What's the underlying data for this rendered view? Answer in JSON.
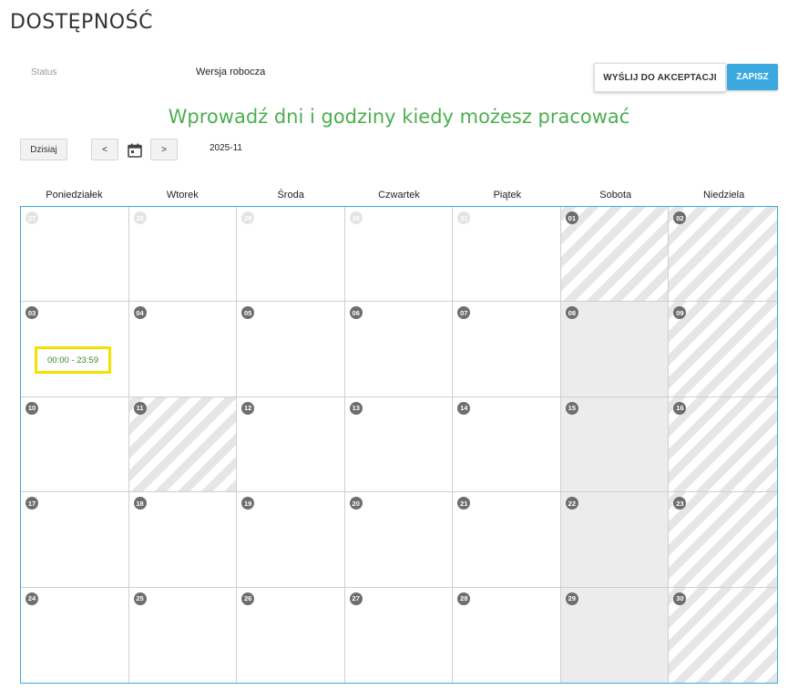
{
  "header": {
    "title": "DOSTĘPNOŚĆ"
  },
  "status": {
    "label": "Status",
    "value": "Wersja robocza"
  },
  "actions": {
    "send_label": "WYŚLIJ DO AKCEPTACJI",
    "save_label": "ZAPISZ"
  },
  "instructions": "Wprowadź dni i godziny kiedy możesz pracować",
  "toolbar": {
    "today_label": "Dzisiaj",
    "prev_label": "<",
    "next_label": ">",
    "calendar_icon": "calendar-icon",
    "month": "2025-11"
  },
  "colors": {
    "accent": "#3ba9e0",
    "instructions_green": "#4caf50",
    "highlight_yellow": "#f5e000"
  },
  "weekdays": [
    "Poniedziałek",
    "Wtorek",
    "Środa",
    "Czwartek",
    "Piątek",
    "Sobota",
    "Niedziela"
  ],
  "weeks": [
    [
      {
        "day": "27",
        "state": "outside"
      },
      {
        "day": "28",
        "state": "outside"
      },
      {
        "day": "29",
        "state": "outside"
      },
      {
        "day": "30",
        "state": "outside"
      },
      {
        "day": "31",
        "state": "outside"
      },
      {
        "day": "01",
        "state": "striped"
      },
      {
        "day": "02",
        "state": "striped"
      }
    ],
    [
      {
        "day": "03",
        "state": "normal",
        "slot": "00:00 - 23:59"
      },
      {
        "day": "04",
        "state": "normal"
      },
      {
        "day": "05",
        "state": "normal"
      },
      {
        "day": "06",
        "state": "normal"
      },
      {
        "day": "07",
        "state": "normal"
      },
      {
        "day": "08",
        "state": "gray"
      },
      {
        "day": "09",
        "state": "striped"
      }
    ],
    [
      {
        "day": "10",
        "state": "normal"
      },
      {
        "day": "11",
        "state": "striped"
      },
      {
        "day": "12",
        "state": "normal"
      },
      {
        "day": "13",
        "state": "normal"
      },
      {
        "day": "14",
        "state": "normal"
      },
      {
        "day": "15",
        "state": "gray"
      },
      {
        "day": "16",
        "state": "striped"
      }
    ],
    [
      {
        "day": "17",
        "state": "normal"
      },
      {
        "day": "18",
        "state": "normal"
      },
      {
        "day": "19",
        "state": "normal"
      },
      {
        "day": "20",
        "state": "normal"
      },
      {
        "day": "21",
        "state": "normal"
      },
      {
        "day": "22",
        "state": "gray"
      },
      {
        "day": "23",
        "state": "striped"
      }
    ],
    [
      {
        "day": "24",
        "state": "normal"
      },
      {
        "day": "25",
        "state": "normal"
      },
      {
        "day": "26",
        "state": "normal"
      },
      {
        "day": "27",
        "state": "normal"
      },
      {
        "day": "28",
        "state": "normal"
      },
      {
        "day": "29",
        "state": "gray"
      },
      {
        "day": "30",
        "state": "striped"
      }
    ]
  ]
}
